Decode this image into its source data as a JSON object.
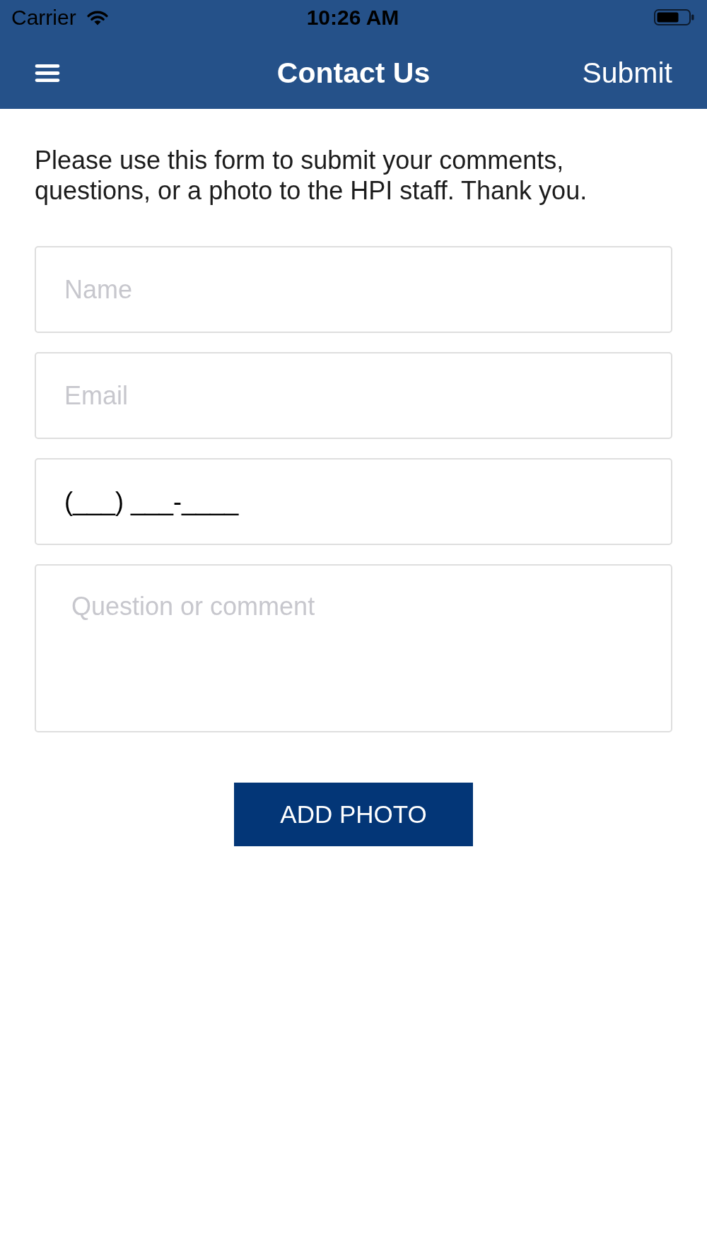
{
  "status_bar": {
    "carrier": "Carrier",
    "time": "10:26 AM"
  },
  "nav_bar": {
    "title": "Contact Us",
    "action": "Submit"
  },
  "intro": "Please use this form to submit your comments, questions, or a photo to the HPI staff. Thank you.",
  "fields": [
    {
      "kind": "text",
      "placeholder": "Name"
    },
    {
      "kind": "text",
      "placeholder": "Email"
    },
    {
      "kind": "text",
      "value": "(___) ___-____"
    },
    {
      "kind": "textarea",
      "placeholder": "Question or comment"
    }
  ],
  "add_photo_button": {
    "label": "ADD PHOTO"
  }
}
